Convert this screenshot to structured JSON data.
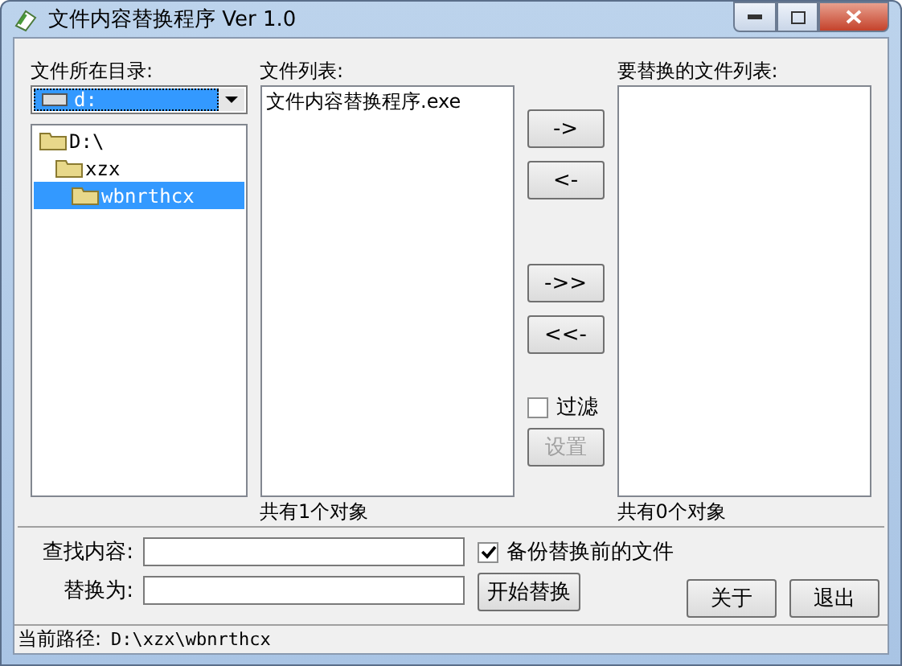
{
  "window": {
    "title": "文件内容替换程序 Ver 1.0"
  },
  "directory": {
    "label": "文件所在目录:",
    "drive": "d:",
    "tree": [
      {
        "label": "D:\\",
        "selected": false,
        "children": [
          {
            "label": "xzx",
            "selected": false,
            "children": [
              {
                "label": "wbnrthcx",
                "selected": true
              }
            ]
          }
        ]
      }
    ]
  },
  "file_list": {
    "label": "文件列表:",
    "items": [
      "文件内容替换程序.exe"
    ],
    "count": "共有1个对象"
  },
  "move_buttons": [
    "->",
    "<-",
    "->>",
    "<<-"
  ],
  "filter": {
    "label": "过滤",
    "checked": false,
    "settings_button": {
      "label": "设置",
      "disabled": true
    }
  },
  "target_list": {
    "label": "要替换的文件列表:",
    "count": "共有0个对象"
  },
  "find": {
    "label": "查找内容:"
  },
  "replace": {
    "label": "替换为:"
  },
  "backup": {
    "label": "备份替换前的文件",
    "checked": true
  },
  "buttons": [
    {
      "label": "开始替换"
    },
    {
      "label": "关于"
    },
    {
      "label": "退出"
    }
  ],
  "status_bar": {
    "label": "当前路径:",
    "path": "D:\\xzx\\wbnrthcx"
  }
}
